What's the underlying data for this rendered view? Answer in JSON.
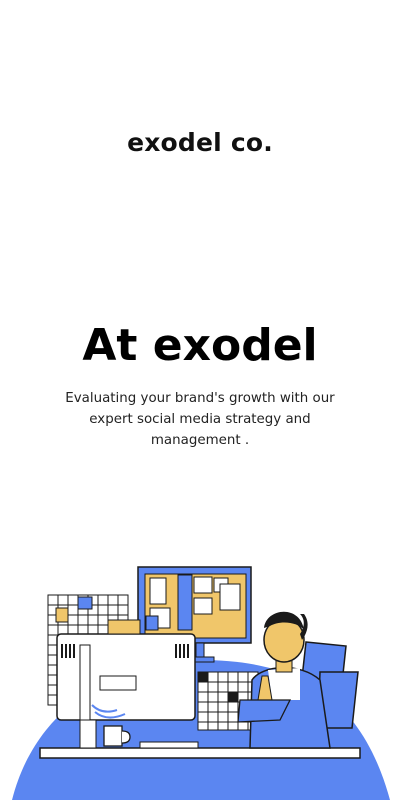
{
  "brand": {
    "name": "exodel co."
  },
  "hero": {
    "title": "At exodel",
    "subtitle": "Evaluating your brand's growth with our expert social media strategy and management ."
  },
  "colors": {
    "background": "#ffffff",
    "accent_blue": "#5b86f1",
    "accent_yellow": "#f0c66a",
    "outline": "#1a1a1a"
  },
  "illustration": {
    "icon": "office-worker-at-desk-illustration"
  }
}
